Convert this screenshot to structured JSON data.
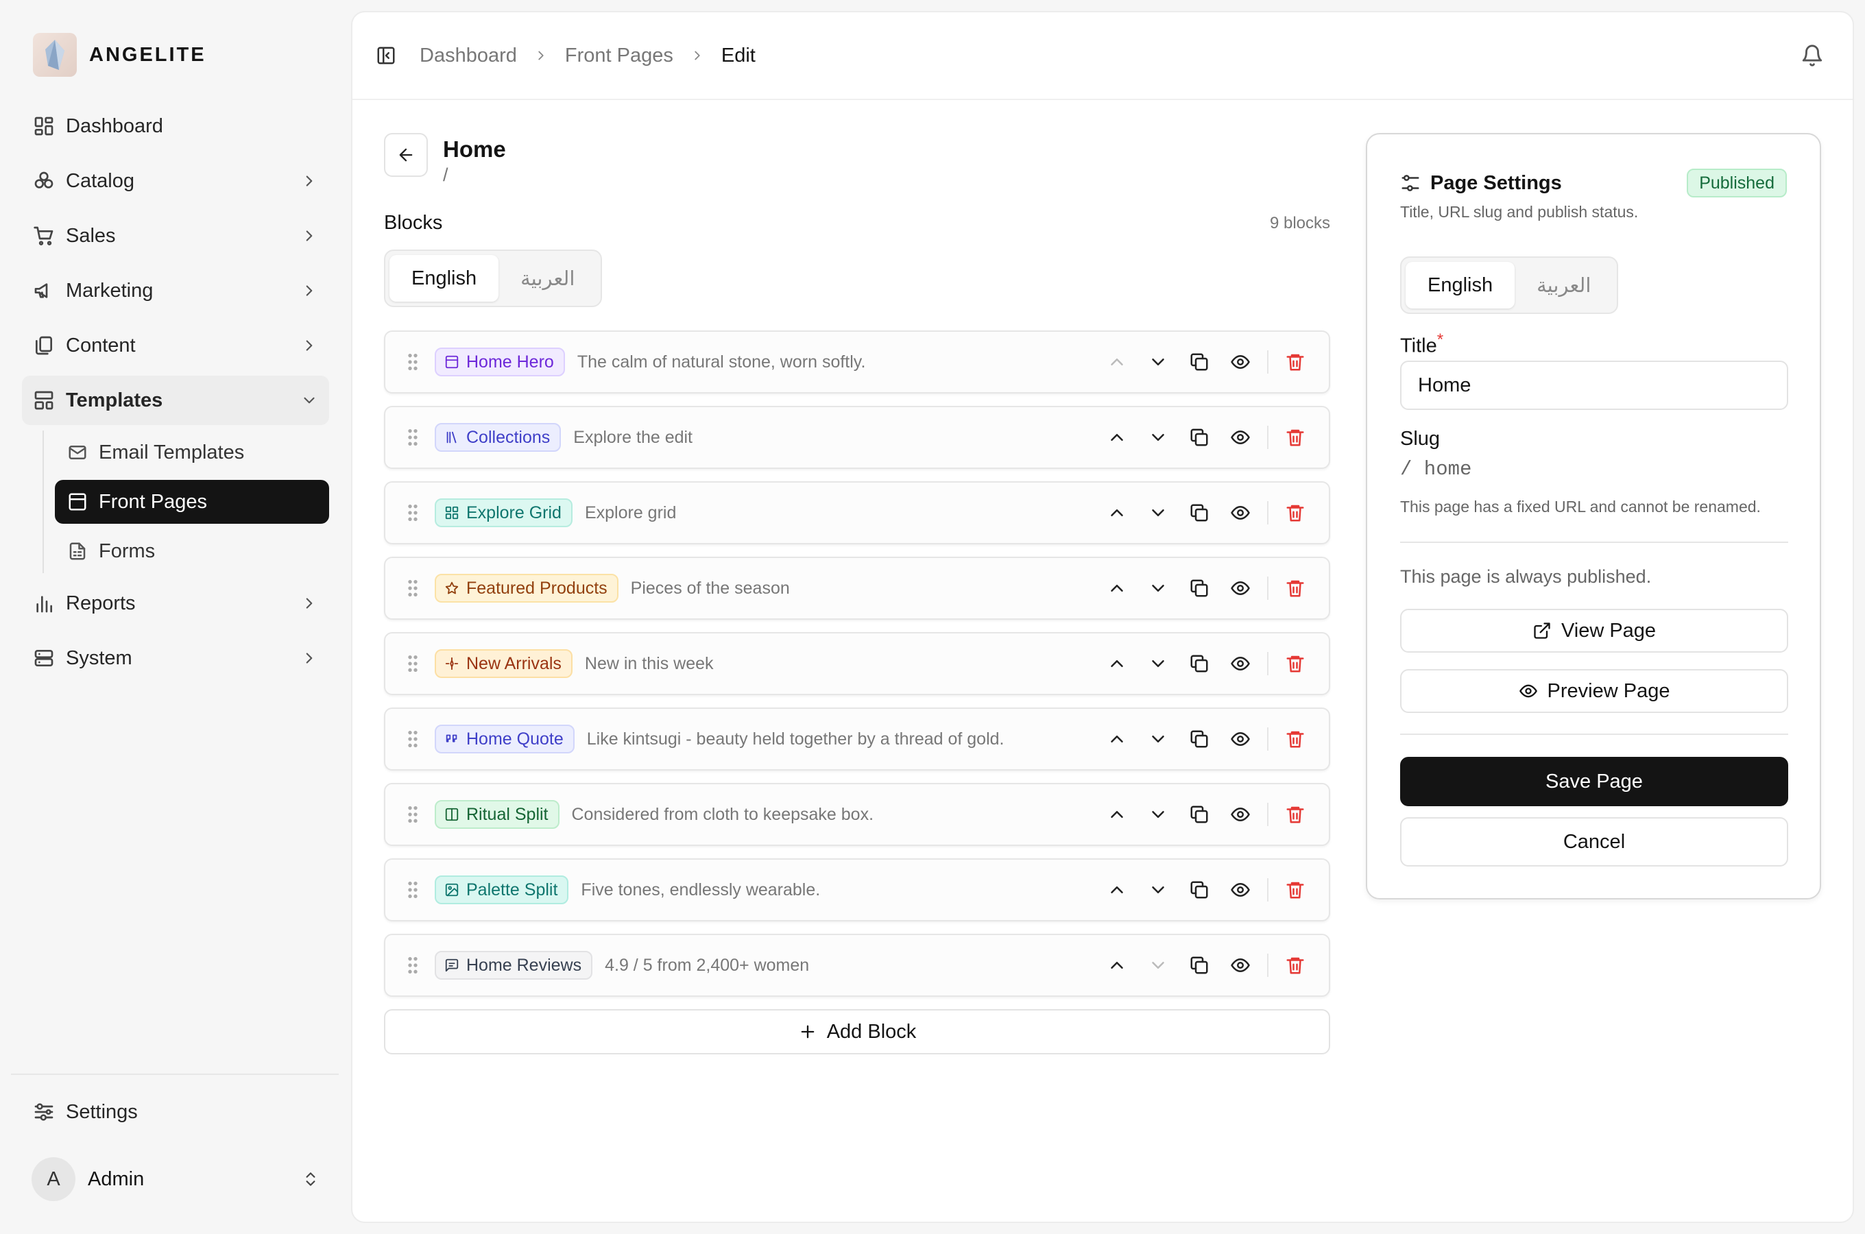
{
  "brand": {
    "name": "ANGELITE"
  },
  "sidebar": {
    "items": [
      {
        "label": "Dashboard",
        "icon": "dashboard-icon"
      },
      {
        "label": "Catalog",
        "icon": "catalog-icon"
      },
      {
        "label": "Sales",
        "icon": "cart-icon"
      },
      {
        "label": "Marketing",
        "icon": "megaphone-icon"
      },
      {
        "label": "Content",
        "icon": "copy-icon"
      },
      {
        "label": "Templates",
        "icon": "templates-icon"
      },
      {
        "label": "Reports",
        "icon": "bar-chart-icon"
      },
      {
        "label": "System",
        "icon": "server-icon"
      }
    ],
    "templates_sub": [
      {
        "label": "Email Templates",
        "icon": "mail-icon"
      },
      {
        "label": "Front Pages",
        "icon": "panel-icon"
      },
      {
        "label": "Forms",
        "icon": "form-icon"
      }
    ],
    "settings_label": "Settings",
    "user": {
      "initial": "A",
      "name": "Admin"
    }
  },
  "breadcrumb": [
    "Dashboard",
    "Front Pages",
    "Edit"
  ],
  "page": {
    "title": "Home",
    "slug": "/"
  },
  "blocks": {
    "title": "Blocks",
    "count": "9 blocks",
    "lang_tabs": [
      "English",
      "العربية"
    ],
    "items": [
      {
        "name": "Home Hero",
        "subtitle": "The calm of natural stone, worn softly.",
        "color": "#6d28d9",
        "bg": "#f1ebff",
        "border": "#ddd0ff"
      },
      {
        "name": "Collections",
        "subtitle": "Explore the edit",
        "color": "#3f3fc8",
        "bg": "#eceefe",
        "border": "#d2d6fb"
      },
      {
        "name": "Explore Grid",
        "subtitle": "Explore grid",
        "color": "#0f766e",
        "bg": "#dcf8f1",
        "border": "#b6ecdf"
      },
      {
        "name": "Featured Products",
        "subtitle": "Pieces of the season",
        "color": "#92400e",
        "bg": "#fef3d7",
        "border": "#fbe2a6"
      },
      {
        "name": "New Arrivals",
        "subtitle": "New in this week",
        "color": "#9a3412",
        "bg": "#fff1d6",
        "border": "#fcdfa4"
      },
      {
        "name": "Home Quote",
        "subtitle": "Like kintsugi - beauty held together by a thread of gold.",
        "color": "#3f3fc8",
        "bg": "#eceefe",
        "border": "#d2d6fb"
      },
      {
        "name": "Ritual Split",
        "subtitle": "Considered from cloth to keepsake box.",
        "color": "#166534",
        "bg": "#e1f8e8",
        "border": "#bdeccb"
      },
      {
        "name": "Palette Split",
        "subtitle": "Five tones, endlessly wearable.",
        "color": "#0f766e",
        "bg": "#d9f7f1",
        "border": "#b0ece0"
      },
      {
        "name": "Home Reviews",
        "subtitle": "4.9 / 5 from 2,400+ women",
        "color": "#374151",
        "bg": "#f4f4f5",
        "border": "#e2e2e4"
      }
    ],
    "add_label": "Add Block"
  },
  "settings": {
    "title": "Page Settings",
    "status": "Published",
    "description": "Title, URL slug and publish status.",
    "lang_tabs": [
      "English",
      "العربية"
    ],
    "title_label": "Title",
    "required_mark": "*",
    "title_value": "Home",
    "slug_label": "Slug",
    "slug_value": "/ home",
    "slug_note": "This page has a fixed URL and cannot be renamed.",
    "always_published": "This page is always published.",
    "view_label": "View Page",
    "preview_label": "Preview Page",
    "save_label": "Save Page",
    "cancel_label": "Cancel"
  }
}
